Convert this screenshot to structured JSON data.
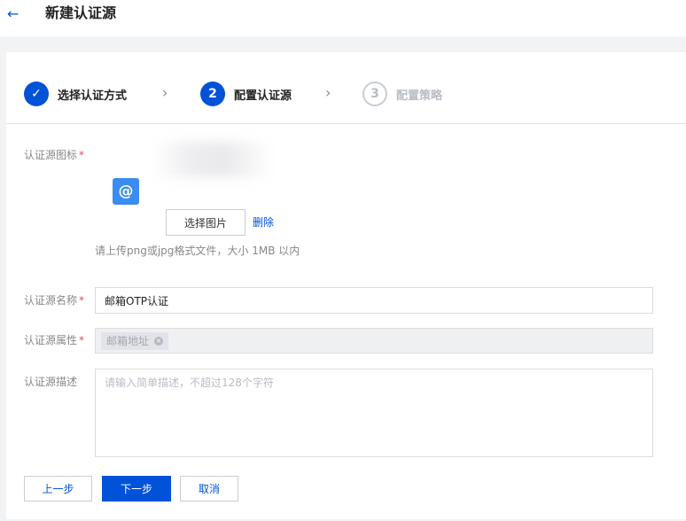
{
  "header": {
    "back_icon": "←",
    "title": "新建认证源"
  },
  "steps": [
    {
      "index": "1",
      "label": "选择认证方式",
      "status": "done",
      "icon": "✓"
    },
    {
      "index": "2",
      "label": "配置认证源",
      "status": "active"
    },
    {
      "index": "3",
      "label": "配置策略",
      "status": "pending"
    }
  ],
  "step_separator": "›",
  "form": {
    "icon_field": {
      "label": "认证源图标",
      "required_mark": "*",
      "icon_glyph": "@",
      "select_button": "选择图片",
      "delete_link": "删除",
      "hint": "请上传png或jpg格式文件，大小 1MB 以内"
    },
    "name_field": {
      "label": "认证源名称",
      "required_mark": "*",
      "value": "邮箱OTP认证"
    },
    "attr_field": {
      "label": "认证源属性",
      "required_mark": "*",
      "tag": "邮箱地址",
      "tag_remove_icon": "×"
    },
    "desc_field": {
      "label": "认证源描述",
      "placeholder": "请输入简单描述，不超过128个字符"
    }
  },
  "actions": {
    "prev": "上一步",
    "next": "下一步",
    "cancel": "取消"
  },
  "colors": {
    "primary": "#0052d9",
    "required": "#e34d59",
    "icon_tile": "#3b8cf0"
  }
}
